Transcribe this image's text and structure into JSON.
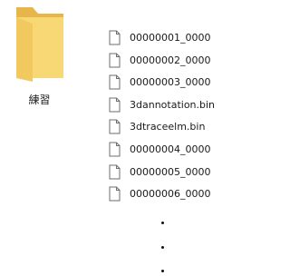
{
  "folder": {
    "label": "練習",
    "icon": "folder-icon"
  },
  "files": [
    {
      "name": "00000001_0000",
      "icon": "file-icon"
    },
    {
      "name": "00000002_0000",
      "icon": "file-icon"
    },
    {
      "name": "00000003_0000",
      "icon": "file-icon"
    },
    {
      "name": "3dannotation.bin",
      "icon": "file-icon"
    },
    {
      "name": "3dtraceelm.bin",
      "icon": "file-icon"
    },
    {
      "name": "00000004_0000",
      "icon": "file-icon"
    },
    {
      "name": "00000005_0000",
      "icon": "file-icon"
    },
    {
      "name": "00000006_0000",
      "icon": "file-icon"
    }
  ],
  "continuation": {
    "dots": 3
  },
  "colors": {
    "folder_body": "#f8d775",
    "folder_back": "#e8b54a",
    "file_outline": "#6e6e6e"
  }
}
